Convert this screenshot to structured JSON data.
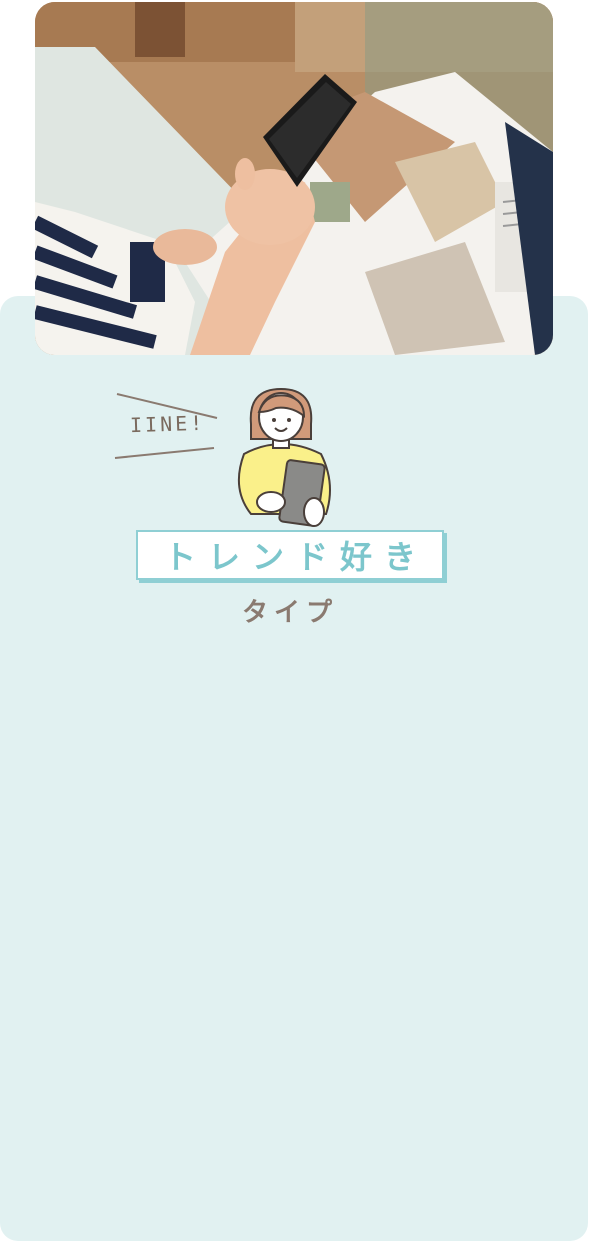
{
  "hero": {
    "image_name": "person-holding-smartphone-over-interior-magazine"
  },
  "badge": {
    "iine_text": "IINE!"
  },
  "illustration": {
    "icon": "woman-holding-tablet-icon"
  },
  "type_card": {
    "title": "トレンド好き",
    "subtitle": "タイプ"
  },
  "colors": {
    "card_background": "#e1f1f1",
    "accent_teal": "#8fcfd4",
    "text_brown": "#8a7a70",
    "shirt_yellow": "#faf08a"
  }
}
